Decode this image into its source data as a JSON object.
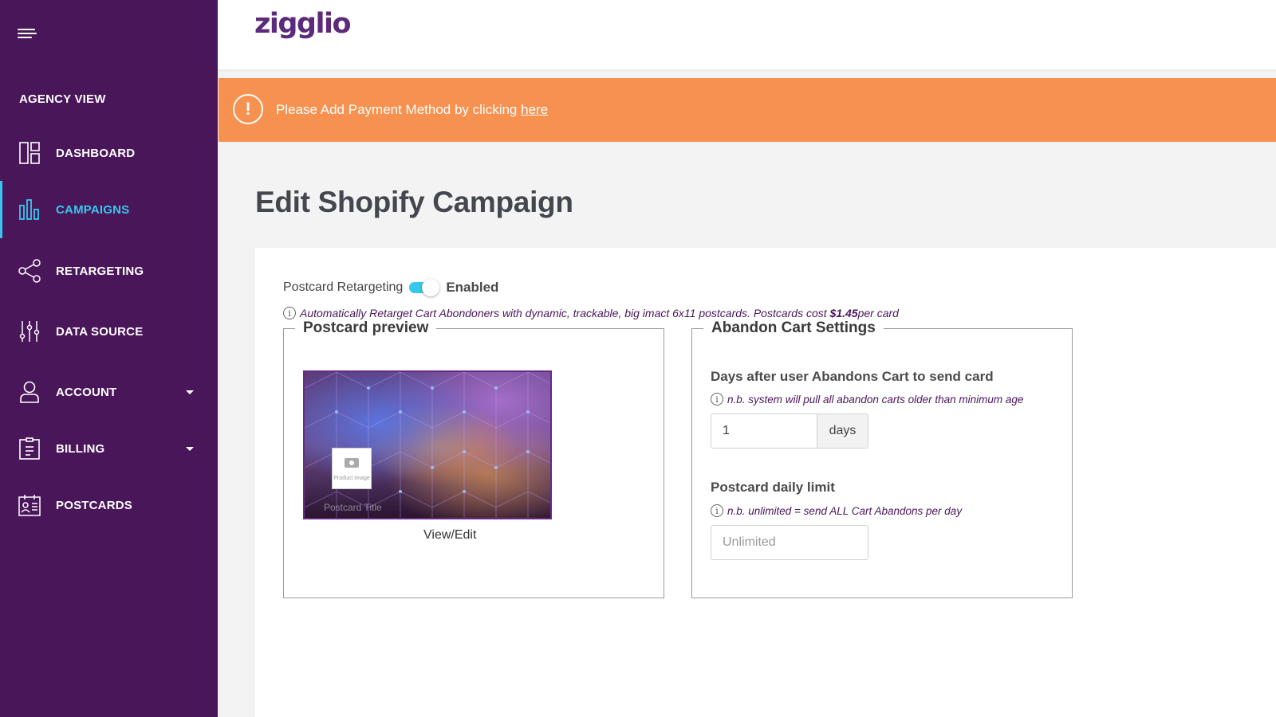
{
  "sidebar": {
    "section_title": "AGENCY VIEW",
    "items": [
      {
        "label": "DASHBOARD",
        "icon": "dashboard-icon"
      },
      {
        "label": "CAMPAIGNS",
        "icon": "bar-chart-icon",
        "active": true
      },
      {
        "label": "RETARGETING",
        "icon": "share-icon"
      },
      {
        "label": "DATA SOURCE",
        "icon": "sliders-icon"
      },
      {
        "label": "ACCOUNT",
        "icon": "user-icon",
        "has_dropdown": true
      },
      {
        "label": "BILLING",
        "icon": "billing-icon",
        "has_dropdown": true
      },
      {
        "label": "POSTCARDS",
        "icon": "postcard-icon"
      }
    ]
  },
  "header": {
    "logo": "zigglio"
  },
  "alert": {
    "icon": "exclamation-icon",
    "text": "Please Add Payment Method by clicking ",
    "link": "here"
  },
  "page": {
    "title": "Edit Shopify Campaign"
  },
  "retargeting": {
    "label": "Postcard Retargeting",
    "toggle_on": true,
    "status": "Enabled",
    "info_prefix": "Automatically Retarget Cart Abondoners with dynamic, trackable, big imact 6x11 postcards. Postcards cost ",
    "info_price": "$1.45",
    "info_suffix": " per card"
  },
  "preview": {
    "legend": "Postcard preview",
    "product_image_text": "Product Image",
    "postcard_title": "Postcard Title",
    "view_edit": "View/Edit"
  },
  "settings": {
    "legend": "Abandon Cart Settings",
    "days_label": "Days after user Abandons Cart to send card",
    "days_note": "n.b. system will pull all abandon carts older than minimum age",
    "days_value": "1",
    "days_unit": "days",
    "limit_label": "Postcard daily limit",
    "limit_note": "n.b. unlimited = send ALL Cart Abandons per day",
    "limit_placeholder": "Unlimited"
  },
  "colors": {
    "sidebar_bg": "#4a165a",
    "accent": "#36c8ec",
    "alert_bg": "#f6914f",
    "brand": "#5c2a7a"
  }
}
